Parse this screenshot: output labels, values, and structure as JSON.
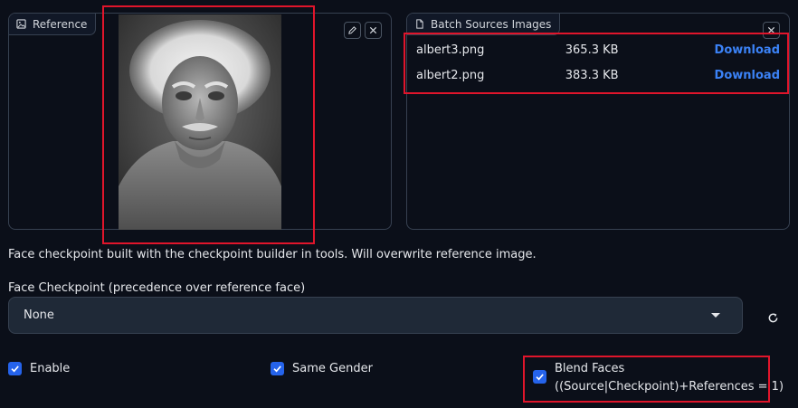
{
  "reference_panel": {
    "label": "Reference"
  },
  "batch_panel": {
    "label": "Batch Sources Images",
    "files": [
      {
        "name": "albert3.png",
        "size": "365.3 KB",
        "action": "Download"
      },
      {
        "name": "albert2.png",
        "size": "383.3 KB",
        "action": "Download"
      }
    ]
  },
  "checkpoint_info": "Face checkpoint built with the checkpoint builder in tools. Will overwrite reference image.",
  "face_checkpoint": {
    "label": "Face Checkpoint (precedence over reference face)",
    "value": "None"
  },
  "options": {
    "enable": {
      "label": "Enable",
      "checked": true
    },
    "same_gender": {
      "label": "Same Gender",
      "checked": true
    },
    "blend_faces": {
      "label": "Blend Faces",
      "sublabel": "((Source|Checkpoint)+References = 1)",
      "checked": true
    }
  },
  "colors": {
    "background": "#0b0f19",
    "accent": "#2563eb",
    "link": "#3b82f6",
    "highlight": "#e0152b"
  }
}
